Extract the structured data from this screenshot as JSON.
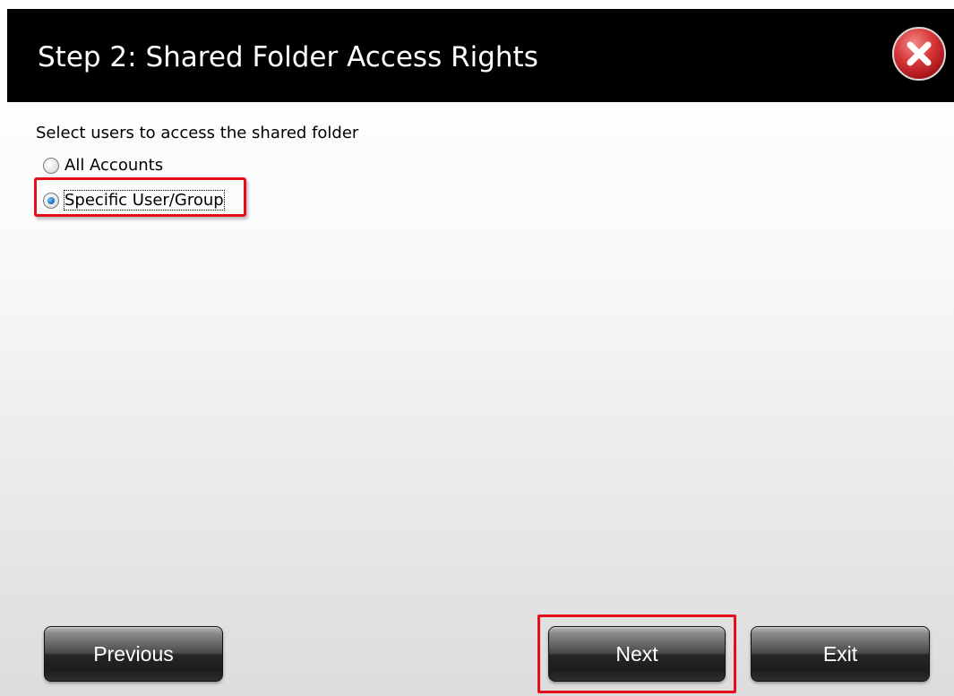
{
  "dialog": {
    "title": "Step 2: Shared Folder Access Rights",
    "close_icon": "close-icon"
  },
  "content": {
    "prompt": "Select users to access the shared folder",
    "options": [
      {
        "label": "All Accounts",
        "selected": false
      },
      {
        "label": "Specific User/Group",
        "selected": true
      }
    ]
  },
  "buttons": {
    "previous_label": "Previous",
    "next_label": "Next",
    "exit_label": "Exit"
  },
  "colors": {
    "titlebar": "#000000",
    "highlight": "#e3101c",
    "close_button": "#d9393a"
  }
}
